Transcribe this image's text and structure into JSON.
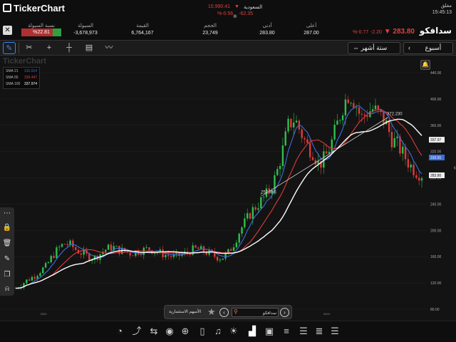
{
  "header": {
    "app_title": "TickerChart",
    "index": {
      "name": "السعودية",
      "value": "10,990.41",
      "change_pct": "%-0.56",
      "change": "-62.35"
    },
    "status": "مغلق",
    "time": "15:45:13"
  },
  "info": {
    "liquidity_ratio_label": "نسبة السيولة",
    "liquidity_ratio_value": "%22.81",
    "liquidity_label": "السيولة",
    "liquidity_value": "-3,678,973",
    "value_label": "القيمة",
    "value_value": "6,764,167",
    "volume_label": "الحجم",
    "volume_value": "23,749",
    "low_label": "أدنى",
    "low_value": "283.80",
    "high_label": "أعلى",
    "high_value": "287.00",
    "symbol_name": "سدافكو",
    "price": "283.80",
    "change": "-2.20",
    "change_pct": "%-0.77"
  },
  "toolbar": {
    "period_label": "ستة أشهر",
    "interval_label": "أسبوع"
  },
  "chart_data": {
    "type": "candlestick",
    "watermark": "TickerChart",
    "ylim": [
      80,
      440
    ],
    "y_ticks": [
      "440.00",
      "400.00",
      "360.00",
      "320.00",
      "280.00",
      "240.00",
      "200.00",
      "160.00",
      "120.00",
      "80.00"
    ],
    "x_ticks": [
      "2020",
      "2024"
    ],
    "indicators": [
      {
        "name": "SMA 21",
        "value": "310.914",
        "color": "#3b6fe0"
      },
      {
        "name": "SMA 55",
        "value": "336.447",
        "color": "#e03a3a"
      },
      {
        "name": "SMA 100",
        "value": "337.974",
        "color": "#ffffff"
      }
    ],
    "price_labels": [
      {
        "text": "337.97",
        "color": "#ffffff",
        "value": 337.97
      },
      {
        "text": "310.91",
        "color": "#3b6fe0",
        "value": 310.91
      },
      {
        "text": "283.80",
        "color": "#ffffff",
        "value": 283.8
      }
    ],
    "annotations": [
      {
        "text": "252.756",
        "x": 0.6,
        "value": 252.756
      },
      {
        "text": "372.230",
        "x": 0.905,
        "value": 372.23
      }
    ],
    "close_series": [
      112,
      118,
      125,
      130,
      138,
      145,
      160,
      172,
      180,
      178,
      170,
      165,
      160,
      158,
      165,
      172,
      175,
      170,
      168,
      165,
      168,
      170,
      172,
      168,
      165,
      162,
      160,
      162,
      165,
      170,
      172,
      168,
      165,
      160,
      158,
      165,
      180,
      200,
      215,
      230,
      240,
      250,
      262,
      285,
      320,
      360,
      370,
      350,
      330,
      320,
      300,
      310,
      330,
      360,
      390,
      410,
      395,
      370,
      380,
      385,
      375,
      365,
      340,
      330,
      315,
      300,
      290,
      285
    ]
  },
  "bottom_nav": {
    "label": "الأسهم الاستثمارية",
    "search_value": "سدافكو"
  }
}
